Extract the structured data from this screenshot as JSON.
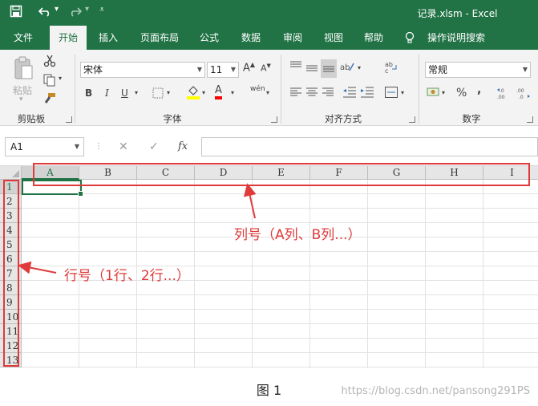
{
  "window": {
    "title": "记录.xlsm  -  Excel"
  },
  "quick_access": {
    "save_icon": "save-icon",
    "undo_icon": "undo-icon",
    "redo_icon": "redo-icon",
    "customize_icon": "customize-icon"
  },
  "tabs": [
    "文件",
    "开始",
    "插入",
    "页面布局",
    "公式",
    "数据",
    "审阅",
    "视图",
    "帮助",
    "操作说明搜索"
  ],
  "active_tab": "开始",
  "ribbon": {
    "clipboard": {
      "paste_label": "粘贴",
      "group_label": "剪贴板"
    },
    "font": {
      "font_name": "宋体",
      "font_size": "11",
      "bold": "B",
      "italic": "I",
      "underline": "U",
      "font_color_glyph": "A",
      "phonetic_glyph": "wén",
      "group_label": "字体"
    },
    "alignment": {
      "group_label": "对齐方式"
    },
    "number": {
      "format": "常规",
      "percent": "%",
      "comma": ",",
      "group_label": "数字"
    }
  },
  "formula_bar": {
    "name_box": "A1",
    "fx_label": "fx",
    "value": ""
  },
  "sheet": {
    "columns": [
      "A",
      "B",
      "C",
      "D",
      "E",
      "F",
      "G",
      "H",
      "I"
    ],
    "rows": [
      "1",
      "2",
      "3",
      "4",
      "5",
      "6",
      "7",
      "8",
      "9",
      "10",
      "11",
      "12",
      "13"
    ],
    "active_cell": "A1"
  },
  "annotations": {
    "columns_note": "列号（A列、B列...）",
    "rows_note": "行号（1行、2行...）"
  },
  "caption": "图 1",
  "watermark": "https://blog.csdn.net/pansong291PS",
  "colors": {
    "excel_green": "#217346",
    "annotation_red": "#e03a3a"
  }
}
